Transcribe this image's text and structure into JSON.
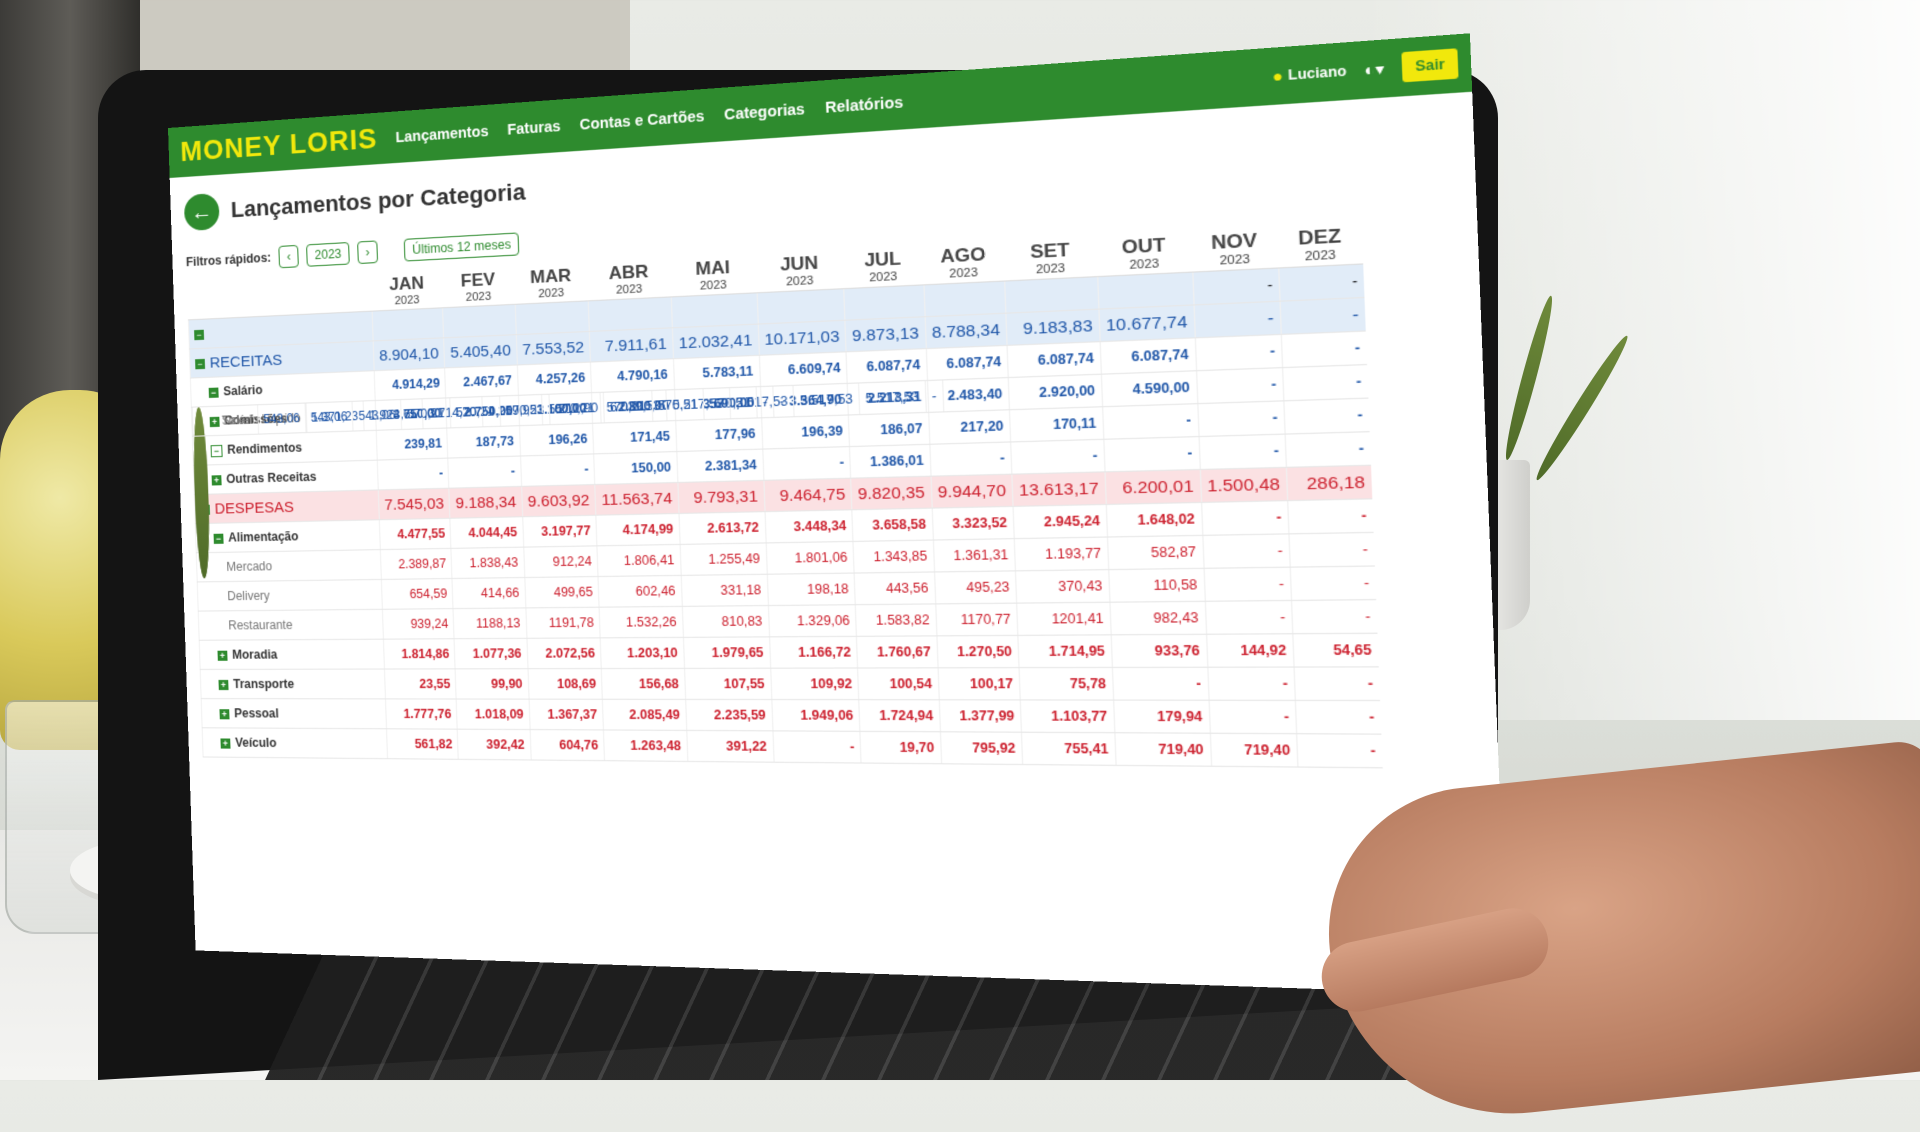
{
  "app": {
    "logo": "MONEY LORIS",
    "nav": [
      "Lançamentos",
      "Faturas",
      "Contas e Cartões",
      "Categorias",
      "Relatórios"
    ],
    "user": "Luciano",
    "logout": "Sair"
  },
  "page": {
    "title": "Lançamentos por Categoria",
    "filters_label": "Filtros rápidos:",
    "year": "2023",
    "last12": "Últimos 12 meses"
  },
  "months": [
    {
      "m": "JAN",
      "y": "2023"
    },
    {
      "m": "FEV",
      "y": "2023"
    },
    {
      "m": "MAR",
      "y": "2023"
    },
    {
      "m": "ABR",
      "y": "2023"
    },
    {
      "m": "MAI",
      "y": "2023"
    },
    {
      "m": "JUN",
      "y": "2023"
    },
    {
      "m": "JUL",
      "y": "2023"
    },
    {
      "m": "AGO",
      "y": "2023"
    },
    {
      "m": "SET",
      "y": "2023"
    },
    {
      "m": "OUT",
      "y": "2023"
    },
    {
      "m": "NOV",
      "y": "2023"
    },
    {
      "m": "DEZ",
      "y": "2023"
    }
  ],
  "rows": [
    {
      "type": "total",
      "name": "",
      "toggle": "minus",
      "values": [
        "",
        "",
        "",
        "",
        "",
        "",
        "",
        "",
        "",
        "",
        "-",
        "-"
      ]
    },
    {
      "type": "receitas",
      "name": "RECEITAS",
      "toggle": "minus",
      "values": [
        "8.904,10",
        "5.405,40",
        "7.553,52",
        "7.911,61",
        "12.032,41",
        "10.171,03",
        "9.873,13",
        "8.788,34",
        "9.183,83",
        "10.677,74",
        "-",
        "-"
      ]
    },
    {
      "type": "sub",
      "name": "Salário",
      "toggle": "minus",
      "values": [
        "4.914,29",
        "2.467,67",
        "4.257,26",
        "4.790,16",
        "5.783,11",
        "6.609,74",
        "6.087,74",
        "6.087,74",
        "6.087,74",
        "6.087,74",
        "-",
        "-"
      ]
    },
    {
      "type": "leaf",
      "name": "Salário Líquido",
      "values": [
        "1.371,23",
        "1.924,61",
        "3.714,20",
        "4.219,95",
        "5.212,90",
        "6.039,53",
        "5.517,53",
        "5.517,53",
        "5.517,53",
        "5.517,53",
        "-",
        "-"
      ]
    },
    {
      "type": "leaf",
      "name": "Ticket",
      "values": [
        "543,06",
        "543,06",
        "543,06",
        "570,21",
        "570,21",
        "570,21",
        "570,21",
        "570,21",
        "570,21",
        "570,21",
        "-",
        "-"
      ]
    },
    {
      "type": "sub",
      "name": "Comissões",
      "toggle": "plus",
      "values": [
        "3.750,00",
        "2.750,00",
        "3.100,00",
        "2.800,00",
        "3.690,00",
        "3.364,90",
        "2.213,31",
        "2.483,40",
        "2.920,00",
        "4.590,00",
        "-",
        "-"
      ]
    },
    {
      "type": "sub",
      "name": "Rendimentos",
      "toggle": "outline",
      "values": [
        "239,81",
        "187,73",
        "196,26",
        "171,45",
        "177,96",
        "196,39",
        "186,07",
        "217,20",
        "170,11",
        "-",
        "-",
        "-"
      ]
    },
    {
      "type": "sub",
      "name": "Outras Receitas",
      "toggle": "plus",
      "values": [
        "-",
        "-",
        "-",
        "150,00",
        "2.381,34",
        "-",
        "1.386,01",
        "-",
        "-",
        "-",
        "-",
        "-"
      ]
    },
    {
      "type": "despesas",
      "name": "DESPESAS",
      "toggle": "minus",
      "values": [
        "7.545,03",
        "9.188,34",
        "9.603,92",
        "11.563,74",
        "9.793,31",
        "9.464,75",
        "9.820,35",
        "9.944,70",
        "13.613,17",
        "6.200,01",
        "1.500,48",
        "286,18"
      ]
    },
    {
      "type": "dsub",
      "name": "Alimentação",
      "toggle": "minus",
      "values": [
        "4.477,55",
        "4.044,45",
        "3.197,77",
        "4.174,99",
        "2.613,72",
        "3.448,34",
        "3.658,58",
        "3.323,52",
        "2.945,24",
        "1.648,02",
        "-",
        "-"
      ]
    },
    {
      "type": "dleaf",
      "name": "Mercado",
      "values": [
        "2.389,87",
        "1.838,43",
        "912,24",
        "1.806,41",
        "1.255,49",
        "1.801,06",
        "1.343,85",
        "1.361,31",
        "1.193,77",
        "582,87",
        "-",
        "-"
      ]
    },
    {
      "type": "dleaf",
      "name": "Delivery",
      "values": [
        "654,59",
        "414,66",
        "499,65",
        "602,46",
        "331,18",
        "198,18",
        "443,56",
        "495,23",
        "370,43",
        "110,58",
        "-",
        "-"
      ]
    },
    {
      "type": "dleaf",
      "name": "Restaurante",
      "values": [
        "939,24",
        "1188,13",
        "1191,78",
        "1.532,26",
        "810,83",
        "1.329,06",
        "1.583,82",
        "1170,77",
        "1201,41",
        "982,43",
        "-",
        "-"
      ]
    },
    {
      "type": "dsub",
      "name": "Moradia",
      "toggle": "plus",
      "values": [
        "1.814,86",
        "1.077,36",
        "2.072,56",
        "1.203,10",
        "1.979,65",
        "1.166,72",
        "1.760,67",
        "1.270,50",
        "1.714,95",
        "933,76",
        "144,92",
        "54,65"
      ]
    },
    {
      "type": "dsub",
      "name": "Transporte",
      "toggle": "plus",
      "values": [
        "23,55",
        "99,90",
        "108,69",
        "156,68",
        "107,55",
        "109,92",
        "100,54",
        "100,17",
        "75,78",
        "-",
        "-",
        "-"
      ]
    },
    {
      "type": "dsub",
      "name": "Pessoal",
      "toggle": "plus",
      "values": [
        "1.777,76",
        "1.018,09",
        "1.367,37",
        "2.085,49",
        "2.235,59",
        "1.949,06",
        "1.724,94",
        "1.377,99",
        "1.103,77",
        "179,94",
        "-",
        "-"
      ]
    },
    {
      "type": "dsub",
      "name": "Veículo",
      "toggle": "plus",
      "values": [
        "561,82",
        "392,42",
        "604,76",
        "1.263,48",
        "391,22",
        "-",
        "19,70",
        "795,92",
        "755,41",
        "719,40",
        "719,40",
        "-"
      ]
    }
  ],
  "colors": {
    "brand_green": "#2e8b2e",
    "brand_yellow": "#f1e80c",
    "income_blue": "#1f56a8",
    "expense_red": "#cc1f2d"
  }
}
